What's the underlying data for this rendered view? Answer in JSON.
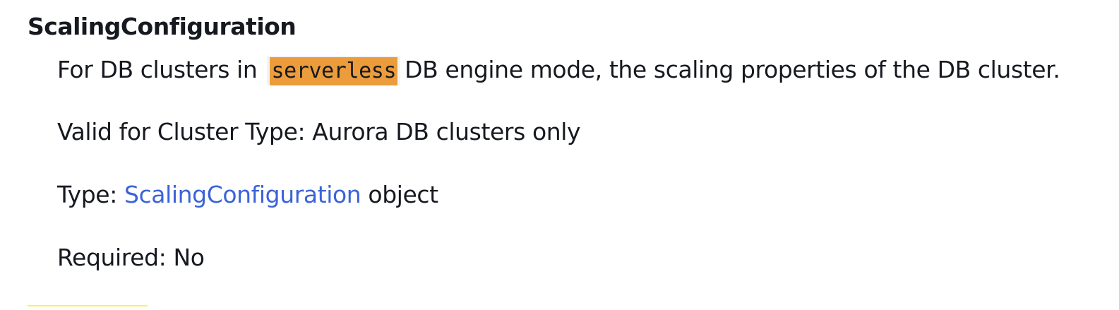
{
  "param": {
    "name": "ScalingConfiguration"
  },
  "description": {
    "prefix": "For DB clusters in",
    "code": "serverless",
    "suffix": "DB engine mode, the scaling properties of the DB cluster."
  },
  "valid_for": {
    "text": "Valid for Cluster Type: Aurora DB clusters only"
  },
  "type": {
    "label": "Type:",
    "link_text": "ScalingConfiguration",
    "suffix": "object"
  },
  "required": {
    "text": "Required: No"
  },
  "colors": {
    "highlight": "#ec9c3b",
    "code_background": "#f2f3f3",
    "link": "#3b63d8",
    "text": "#16191f",
    "bottom_rule": "#f7f259"
  }
}
